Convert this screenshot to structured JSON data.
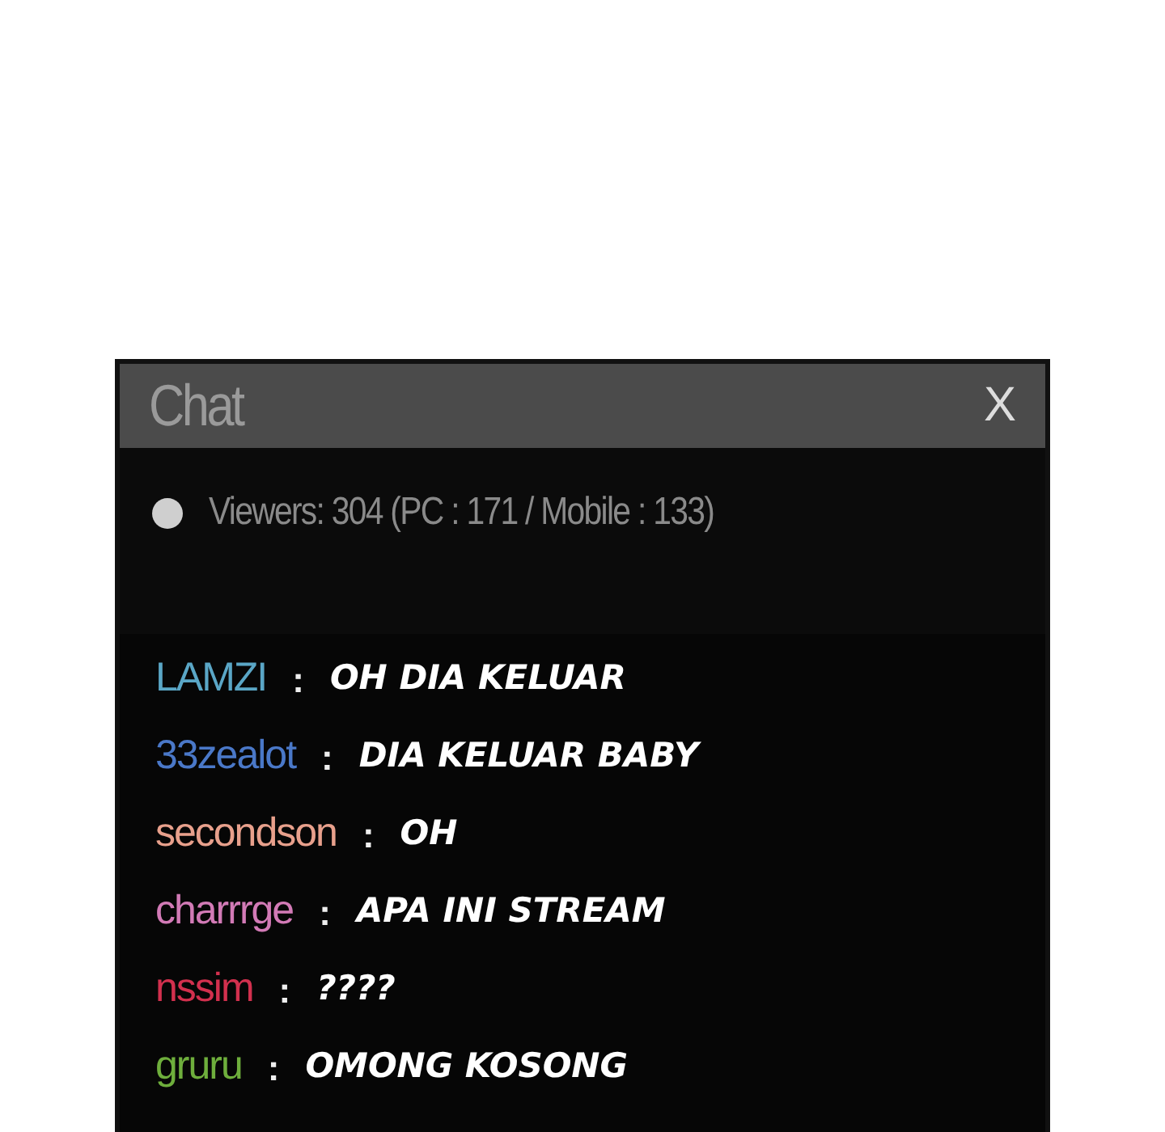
{
  "window": {
    "title": "Chat",
    "close": "X"
  },
  "viewers": {
    "text": "Viewers: 304 (PC : 171 / Mobile : 133)"
  },
  "messages": [
    {
      "user": "LAMZI",
      "separator": ":",
      "text": "OH DIA KELUAR",
      "color": "#5aa6c6"
    },
    {
      "user": "33zealot",
      "separator": ":",
      "text": "DIA KELUAR BABY",
      "color": "#4a78c8"
    },
    {
      "user": "secondson",
      "separator": ":",
      "text": "OH",
      "color": "#e8a08c"
    },
    {
      "user": "charrrge",
      "separator": ":",
      "text": "APA INI STREAM",
      "color": "#d27ab6"
    },
    {
      "user": "nssim",
      "separator": ":",
      "text": "????",
      "color": "#d2304e"
    },
    {
      "user": "gruru",
      "separator": ":",
      "text": "OMONG KOSONG",
      "color": "#6eae3c"
    }
  ]
}
